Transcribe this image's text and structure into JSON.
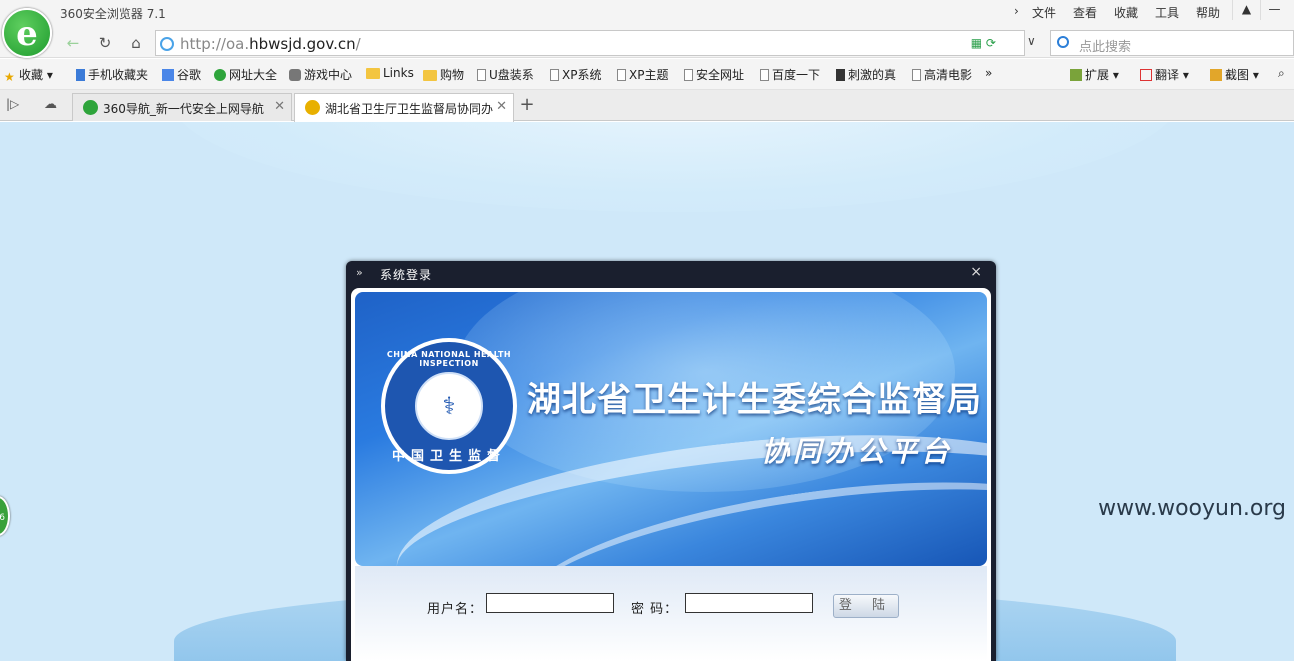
{
  "browser": {
    "title": "360安全浏览器 7.1",
    "logo_letter": "e",
    "menu": [
      "文件",
      "查看",
      "收藏",
      "工具",
      "帮助"
    ],
    "window_buttons": [
      "shirt-icon",
      "minimize-icon"
    ]
  },
  "address": {
    "url_prefix": "http://oa.",
    "url_domain": "hbwsjd.gov.cn",
    "url_suffix": "/",
    "search_placeholder": "点此搜索"
  },
  "bookmarks": {
    "favorites": "收藏",
    "items": [
      "手机收藏夹",
      "谷歌",
      "网址大全",
      "游戏中心",
      "Links",
      "购物",
      "U盘装系",
      "XP系统",
      "XP主题",
      "安全网址",
      "百度一下",
      "刺激的真",
      "高清电影"
    ],
    "more": "»",
    "extend": "扩展",
    "translate": "翻译",
    "screenshot": "截图"
  },
  "tabs": [
    {
      "title": "360导航_新一代安全上网导航",
      "active": false
    },
    {
      "title": "湖北省卫生厅卫生监督局协同办",
      "active": true
    }
  ],
  "dialog": {
    "title": "系统登录",
    "org_name": "湖北省卫生计生委综合监督局",
    "platform_name": "协同办公平台",
    "emblem_top": "CHINA NATIONAL HEALTH INSPECTION",
    "emblem_bottom": "中国卫生监督",
    "username_label": "用户名：",
    "username_value": "",
    "password_label": "密 码：",
    "password_value": "",
    "login_label": "登 陆"
  },
  "side_badge": "6",
  "watermark": "www.wooyun.org"
}
